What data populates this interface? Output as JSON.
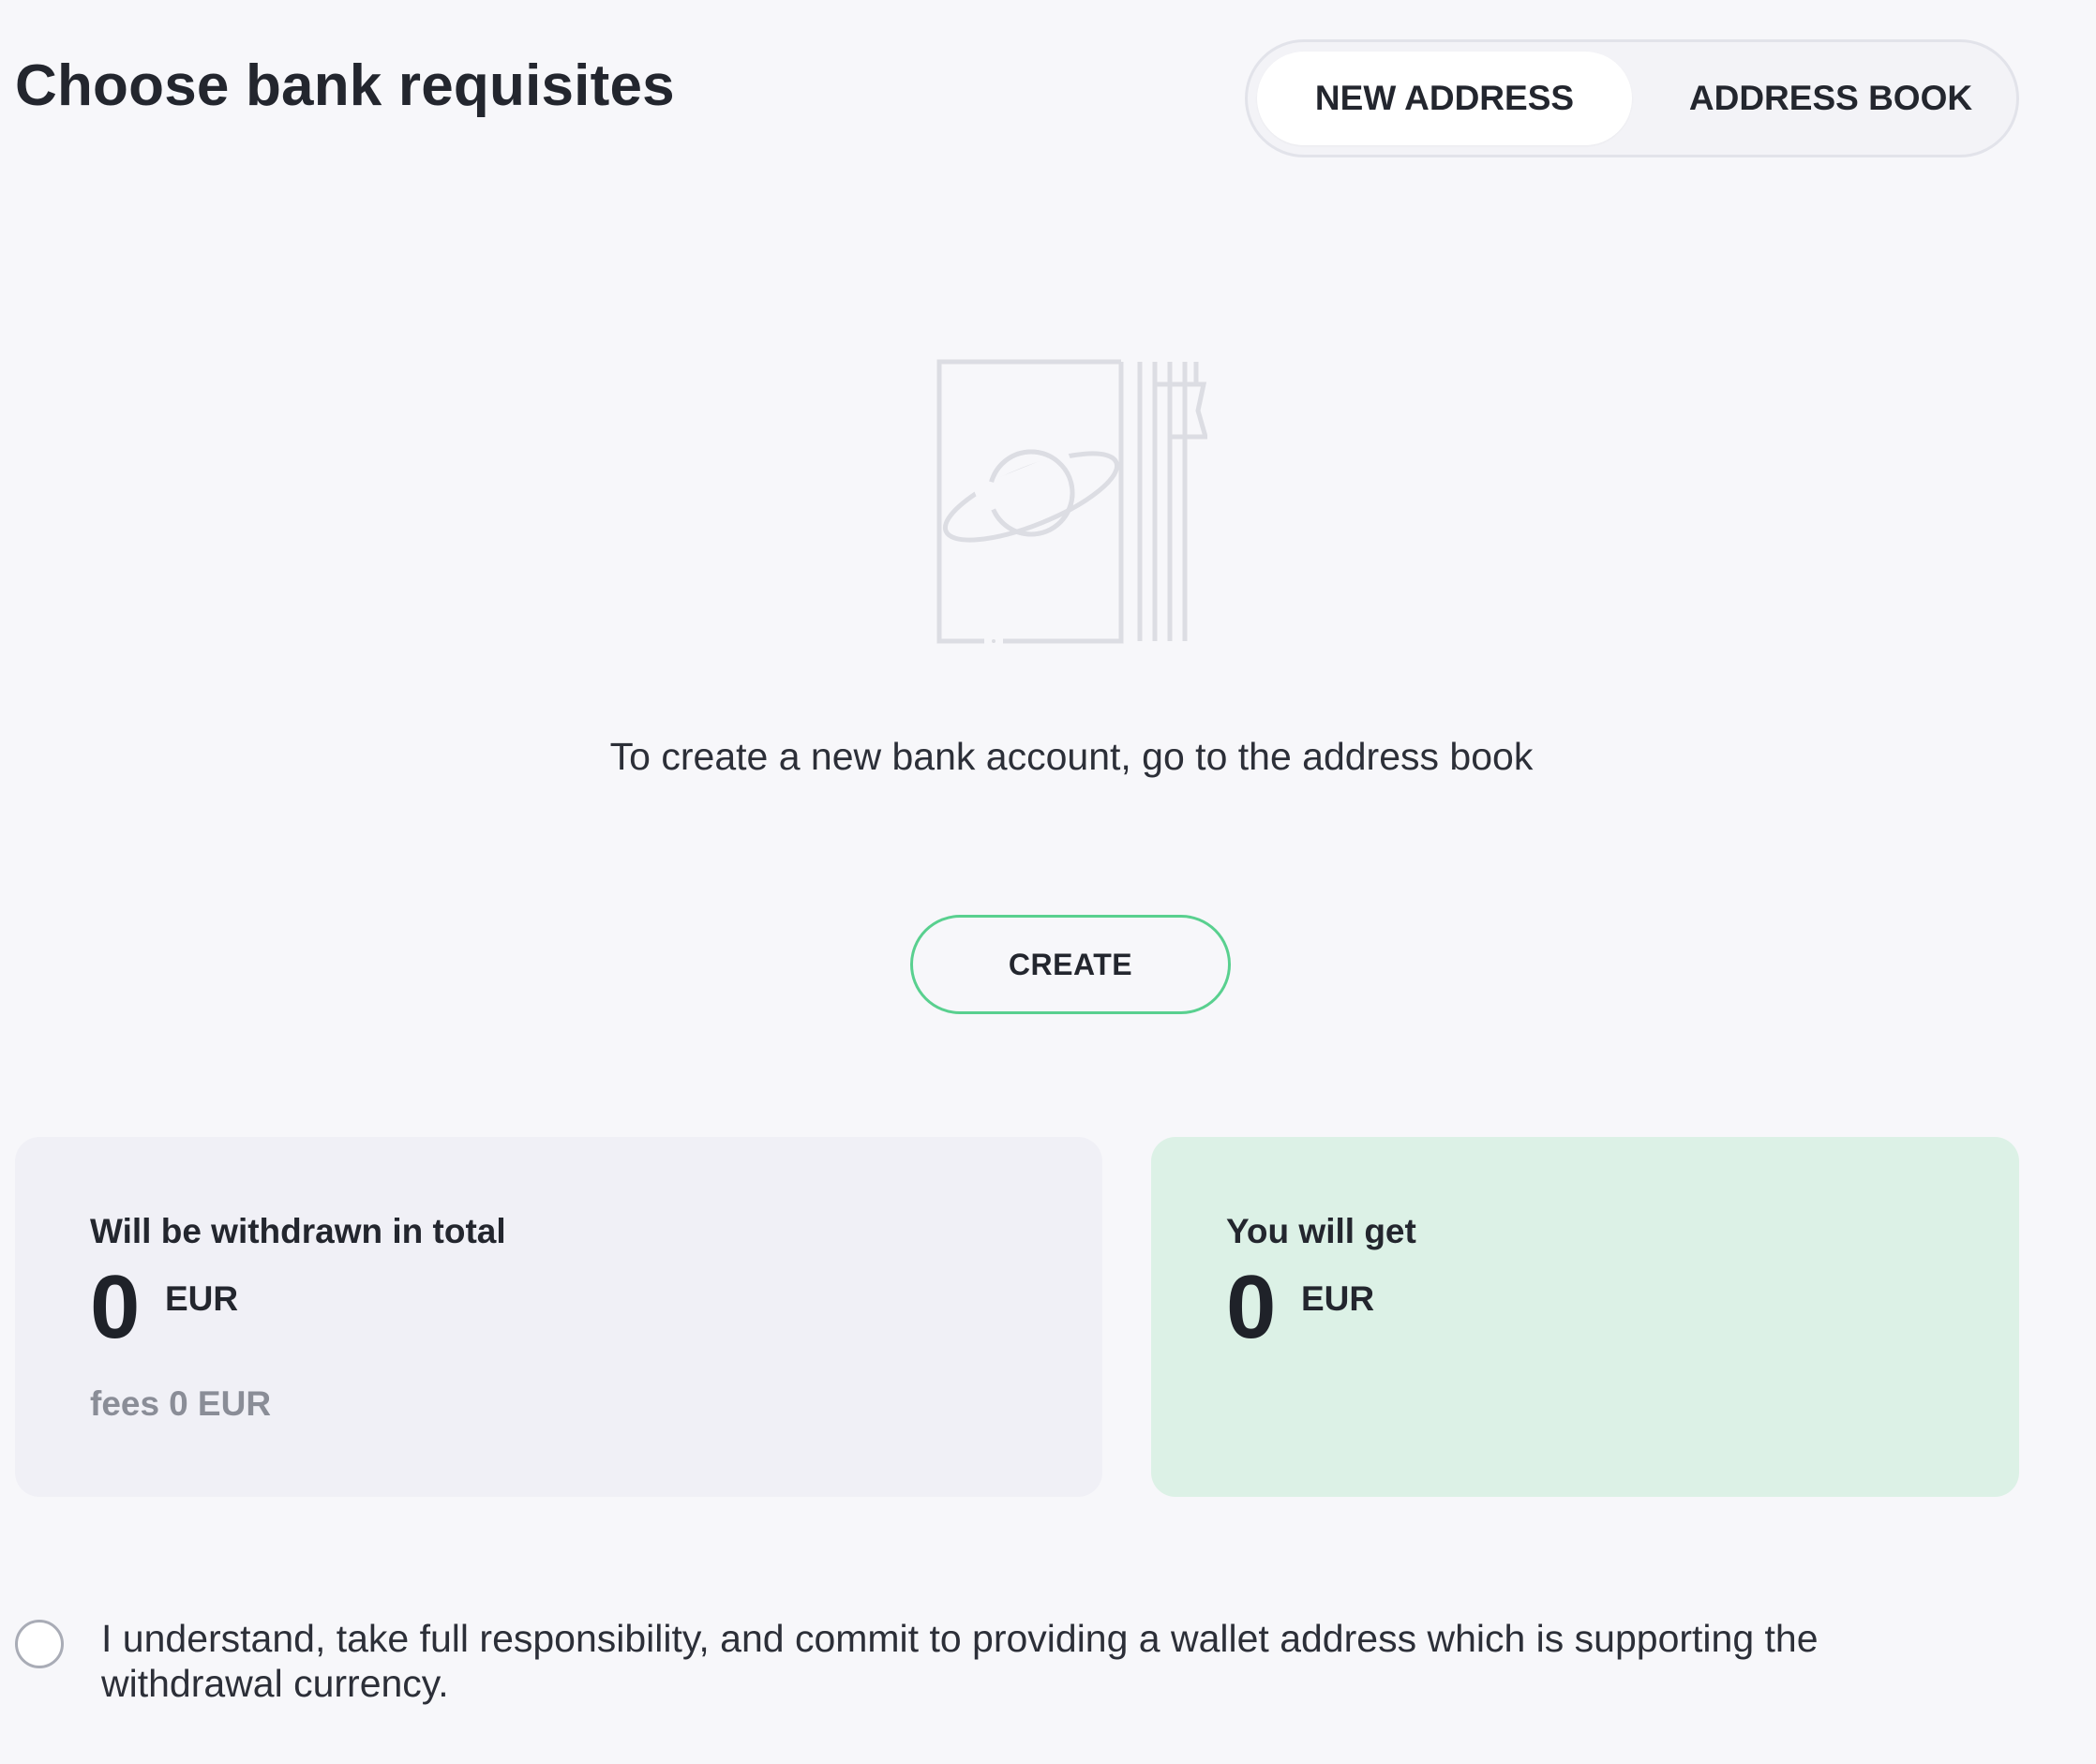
{
  "header": {
    "title": "Choose bank requisites"
  },
  "tabs": [
    {
      "label": "NEW ADDRESS",
      "active": true
    },
    {
      "label": "ADDRESS BOOK",
      "active": false
    }
  ],
  "empty_state": {
    "icon": "address-book-planet-icon",
    "message": "To create a new bank account, go to the address book",
    "button_label": "CREATE"
  },
  "summary": {
    "withdrawn": {
      "label": "Will be withdrawn in total",
      "amount": "0",
      "currency": "EUR",
      "fees_label": "fees",
      "fees_value": "0 EUR"
    },
    "receive": {
      "label": "You will get",
      "amount": "0",
      "currency": "EUR"
    }
  },
  "consent": {
    "checked": false,
    "text": "I understand, take full responsibility, and commit to providing a wallet address which is supporting the withdrawal currency."
  },
  "colors": {
    "background": "#f7f7fa",
    "accent_green": "#59d08f",
    "receive_card": "#dcf1e6",
    "withdraw_card": "#f0f0f6"
  }
}
